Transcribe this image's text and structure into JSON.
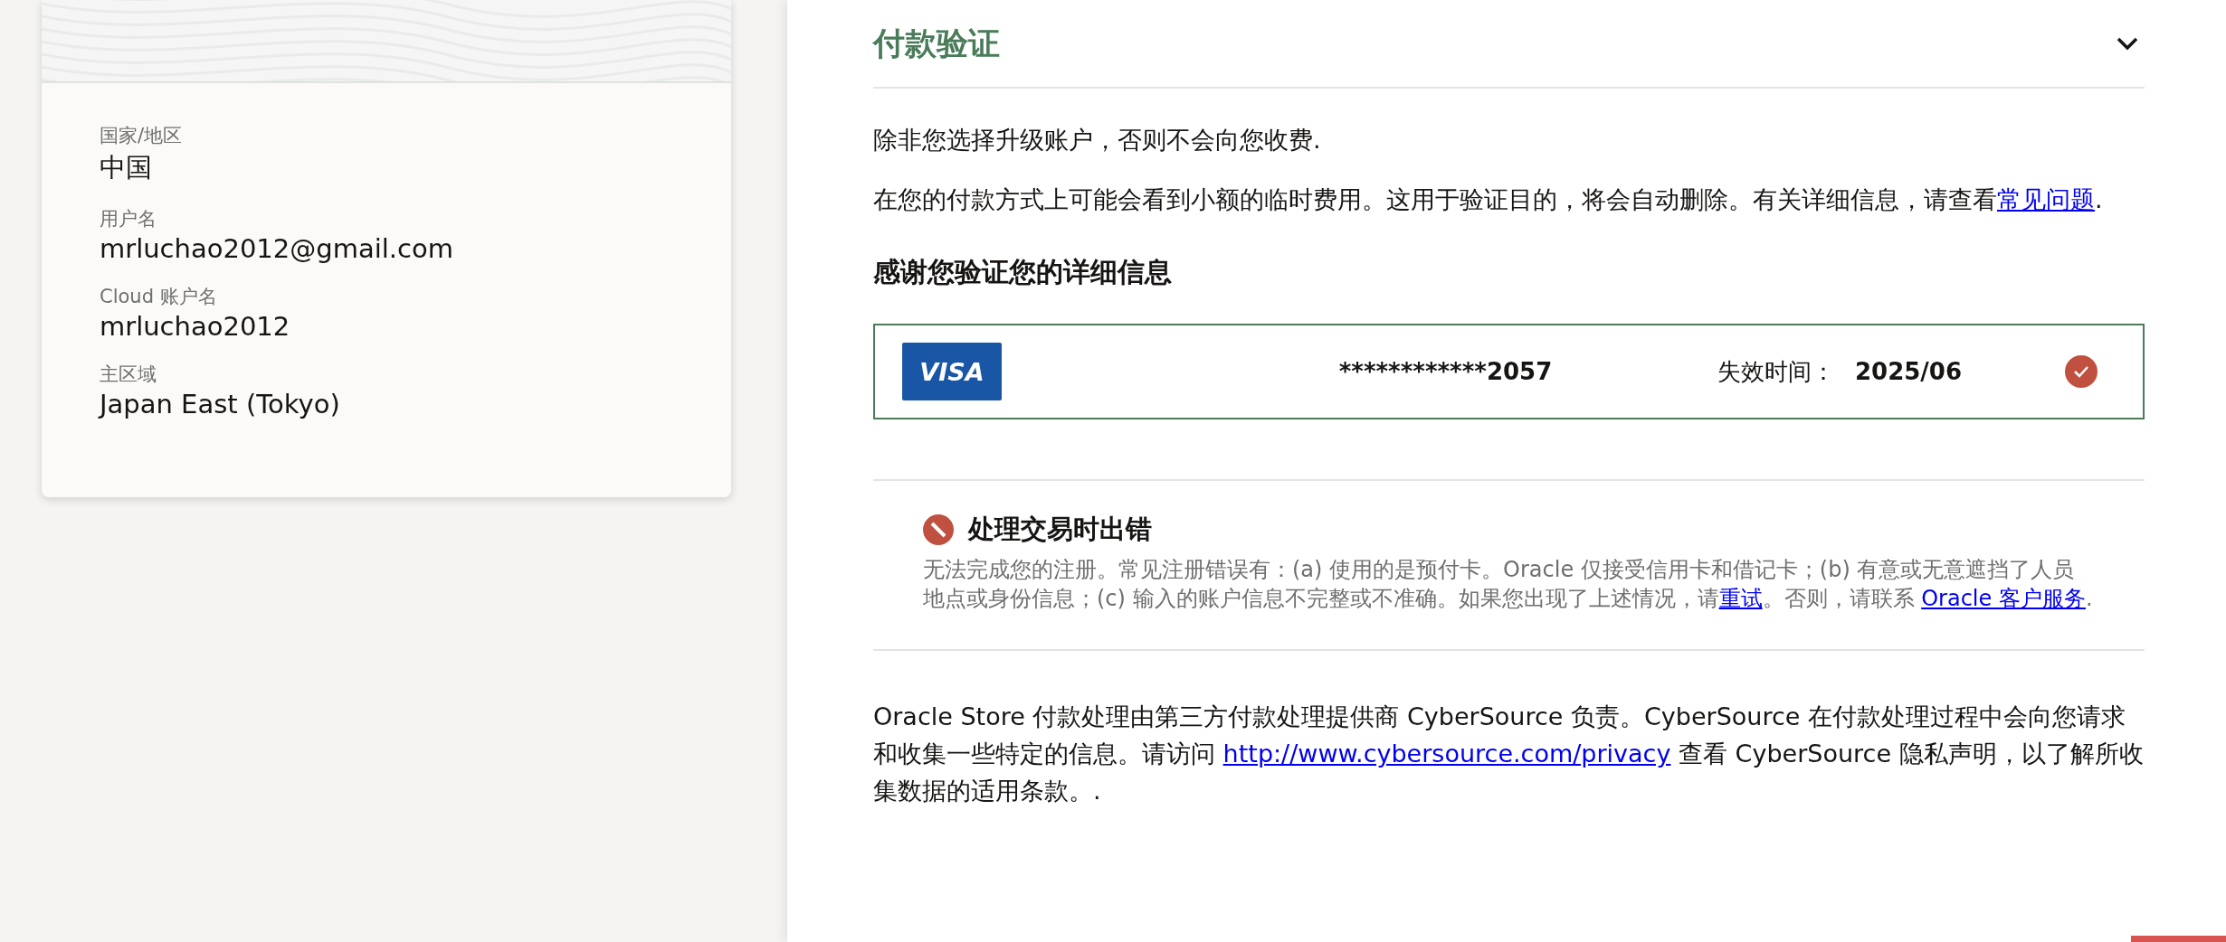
{
  "account_card": {
    "fields": [
      {
        "label": "国家/地区",
        "value": "中国"
      },
      {
        "label": "用户名",
        "value": "mrluchao2012@gmail.com"
      },
      {
        "label": "Cloud 账户名",
        "value": "mrluchao2012"
      },
      {
        "label": "主区域",
        "value": "Japan East (Tokyo)"
      }
    ]
  },
  "payment_section": {
    "title": "付款验证",
    "expanded": true,
    "notice": "除非您选择升级账户，否则不会向您收费.",
    "info": {
      "text": "在您的付款方式上可能会看到小额的临时费用。这用于验证目的，将会自动删除。有关详细信息，请查看",
      "link": "常见问题",
      "after": "."
    },
    "thanks_heading": "感谢您验证您的详细信息",
    "card": {
      "brand": "VISA",
      "number": "************2057",
      "expiry_label": "失效时间：",
      "expiry": "2025/06",
      "verified": true
    }
  },
  "error": {
    "title": "处理交易时出错",
    "text": "无法完成您的注册。常见注册错误有：(a) 使用的是预付卡。Oracle 仅接受信用卡和借记卡；(b) 有意或无意遮挡了人员地点或身份信息；(c) 输入的账户信息不完整或不准确。如果您出现了上述情况，请",
    "retry_link": "重试",
    "text2": "。否则，请联系 ",
    "support_link": "Oracle 客户服务",
    "text3": "."
  },
  "footer": {
    "text": "Oracle Store 付款处理由第三方付款处理提供商 CyberSource 负责。CyberSource 在付款处理过程中会向您请求和收集一些特定的信息。请访问 ",
    "link": "http://www.cybersource.com/privacy",
    "after": " 查看 CyberSource 隐私声明，以了解所收集数据的适用条款。."
  }
}
